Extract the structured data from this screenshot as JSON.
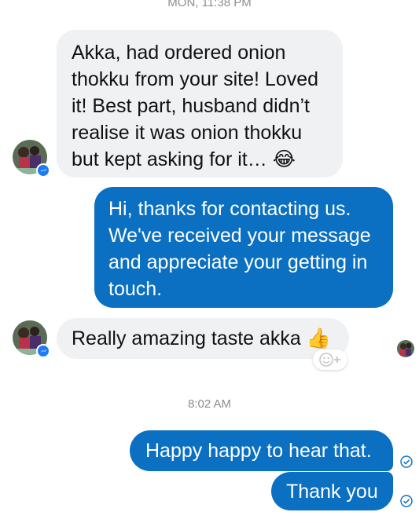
{
  "thread": {
    "timestamp_top": "MON, 11:38 PM",
    "timestamp_bottom": "8:02 AM"
  },
  "messages": [
    {
      "id": "m1",
      "direction": "incoming",
      "text": "Akka, had ordered onion thokku from your site! Loved it! Best part, husband didn’t realise it was onion thokku but kept asking for it…",
      "emoji": "😂"
    },
    {
      "id": "m2",
      "direction": "outgoing",
      "text": "Hi, thanks for contacting us. We've received your message and appreciate your getting in touch."
    },
    {
      "id": "m3",
      "direction": "incoming",
      "text": "Really amazing taste akka",
      "emoji": "👍"
    },
    {
      "id": "m4",
      "direction": "outgoing",
      "text": "Happy happy to hear that."
    },
    {
      "id": "m5",
      "direction": "outgoing",
      "text": "Thank you"
    }
  ],
  "icons": {
    "avatar_badge": "messenger-icon",
    "add_reaction": "add-reaction-icon",
    "delivered": "delivered-check-icon"
  },
  "colors": {
    "outgoing_bubble": "#0b70c1",
    "incoming_bubble": "#f0f1f3",
    "timestamp": "#8a8d91",
    "badge": "#1e7cf2"
  }
}
